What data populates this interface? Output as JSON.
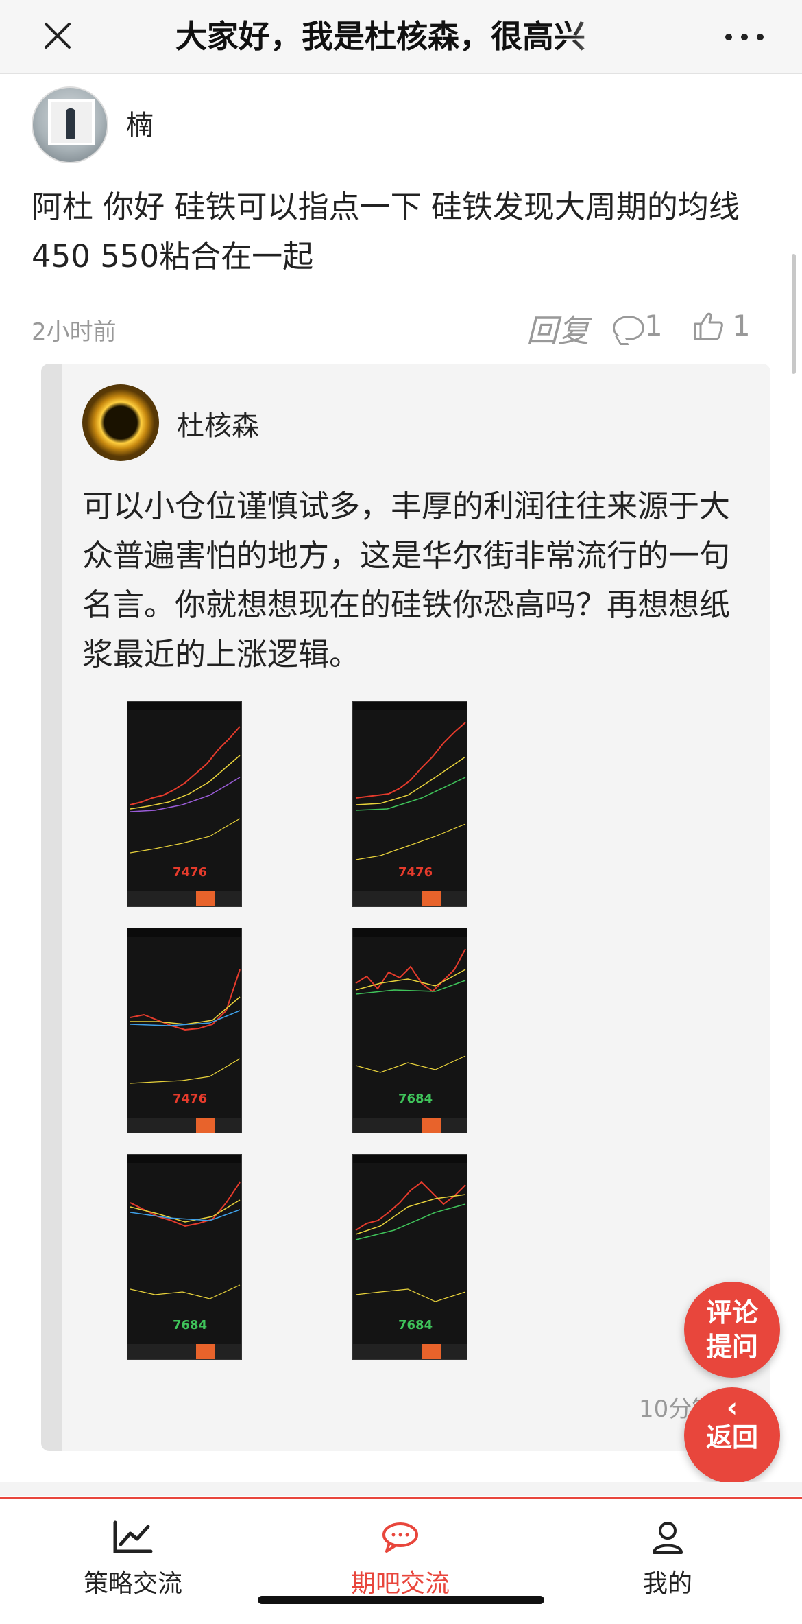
{
  "header": {
    "title": "大家好，我是杜核森，很高兴"
  },
  "post": {
    "username": "楠",
    "text": "阿杜 你好 硅铁可以指点一下 硅铁发现大周期的均线450 550粘合在一起",
    "time": "2小时前",
    "reply_label": "回复",
    "comment_count": "1",
    "like_count": "1"
  },
  "reply": {
    "author": "杜核森",
    "text": "可以小仓位谨慎试多，丰厚的利润往往来源于大众普遍害怕的地方，这是华尔街非常流行的一句名言。你就想想现在的硅铁你恐高吗？再想想纸浆最近的上涨逻辑。",
    "time": "10分钟前",
    "images": [
      {
        "price": "7476",
        "color": "red"
      },
      {
        "price": "7476",
        "color": "red"
      },
      {
        "price": "7476",
        "color": "red"
      },
      {
        "price": "7684",
        "color": "green"
      },
      {
        "price": "7684",
        "color": "green"
      },
      {
        "price": "7684",
        "color": "green"
      }
    ]
  },
  "fab": {
    "comment_line1": "评论",
    "comment_line2": "提问",
    "back_chevron": "‹",
    "back_label": "返回"
  },
  "nav": {
    "items": [
      {
        "label": "策略交流",
        "icon": "chart-trend-icon"
      },
      {
        "label": "期吧交流",
        "icon": "chat-bubble-icon"
      },
      {
        "label": "我的",
        "icon": "person-icon"
      }
    ],
    "active_color": "#e8463c"
  },
  "colors": {
    "accent": "#e8463c",
    "meta_gray": "#999999"
  }
}
